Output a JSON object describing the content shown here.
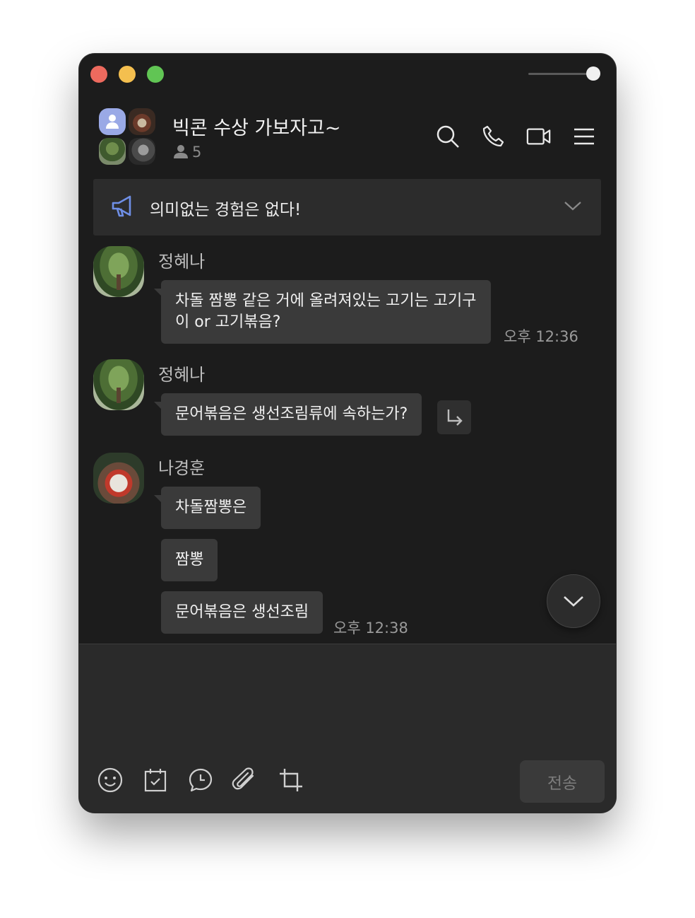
{
  "window": {
    "controls": [
      "close",
      "minimize",
      "zoom"
    ],
    "opacity_slider": 1.0
  },
  "header": {
    "room_title": "빅콘 수상 가보자고~",
    "member_count": "5",
    "icons": [
      "search-icon",
      "phone-icon",
      "video-icon",
      "menu-icon"
    ]
  },
  "notice": {
    "text": "의미없는 경험은 없다!"
  },
  "messages": [
    {
      "sender": "정혜나",
      "lines": [
        "차돌 짬뽕 같은 거에 올려져있는 고기는 고기구",
        "이 or 고기볶음?"
      ],
      "time": "오후 12:36"
    },
    {
      "sender": "정혜나",
      "text": "문어볶음은 생선조림류에 속하는가?"
    },
    {
      "sender": "나경훈",
      "texts": [
        "차돌짬뽕은",
        "짬뽕",
        "문어볶음은 생선조림"
      ],
      "time": "오후 12:38"
    }
  ],
  "composer": {
    "placeholder": "",
    "send_label": "전송",
    "tools": [
      "emoji-icon",
      "calendar-icon",
      "talk-bubble-icon",
      "paperclip-icon",
      "crop-icon"
    ]
  },
  "colors": {
    "window_bg": "#1c1c1c",
    "bubble_bg": "#3a3a3a",
    "notice_icon": "#6f8fe6"
  }
}
